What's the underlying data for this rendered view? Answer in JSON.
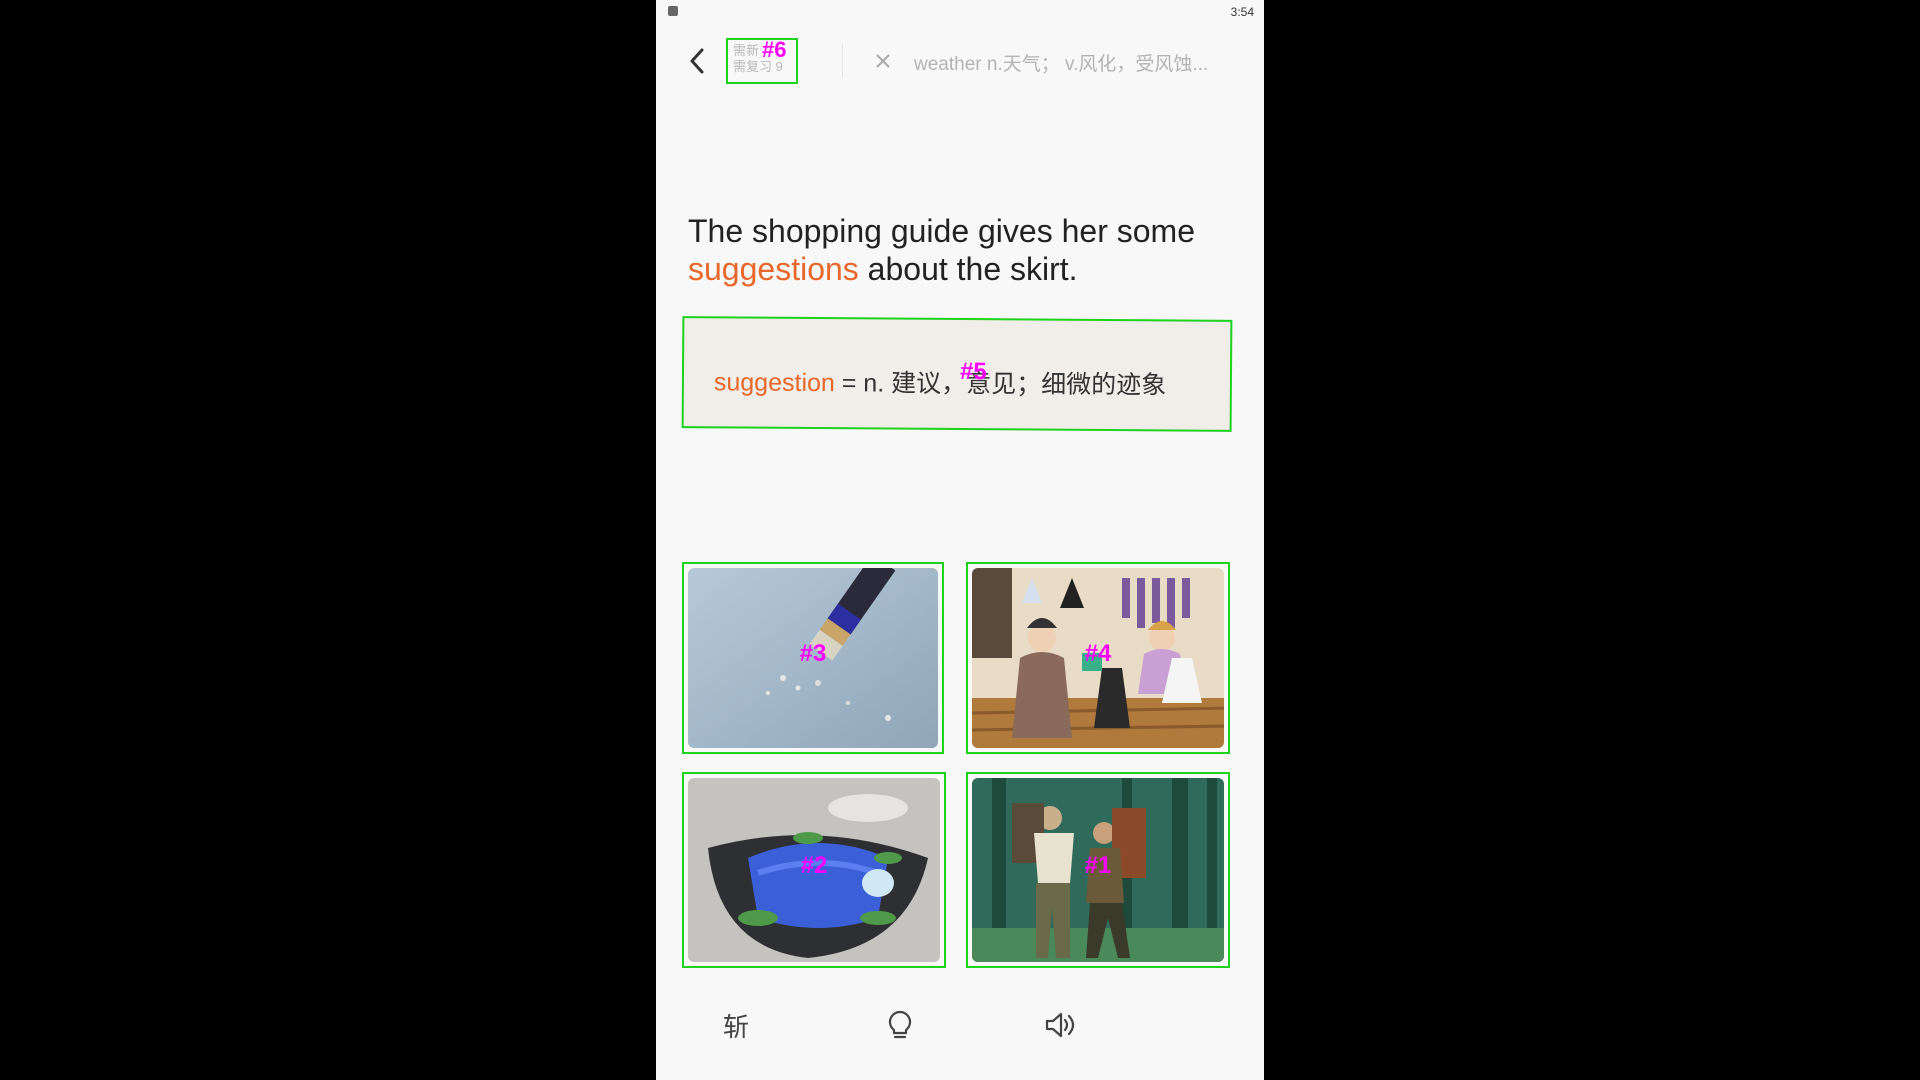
{
  "status": {
    "time": "3:54"
  },
  "header": {
    "counter_line1": "需新",
    "counter_line2": "需复习 9",
    "counter_badge": "#6",
    "prev_word": "weather n.天气； v.风化，受风蚀..."
  },
  "question": {
    "sentence_start": "The shopping guide gives her some ",
    "highlight": "suggestions",
    "sentence_end": " about the skirt."
  },
  "definition": {
    "word": "suggestion",
    "meaning": " = n. 建议，意见；细微的迹象",
    "badge": "#5"
  },
  "choices": [
    {
      "label": "#3",
      "subject": "eraser-pencil"
    },
    {
      "label": "#4",
      "subject": "shopping-guide"
    },
    {
      "label": "#2",
      "subject": "salmon-dish"
    },
    {
      "label": "#1",
      "subject": "hikers-forest"
    }
  ],
  "bottom": {
    "cut_label": "斩"
  },
  "colors": {
    "accent": "#e8672b",
    "highlight_box": "#1ed21e",
    "badge": "#ff00ff"
  }
}
